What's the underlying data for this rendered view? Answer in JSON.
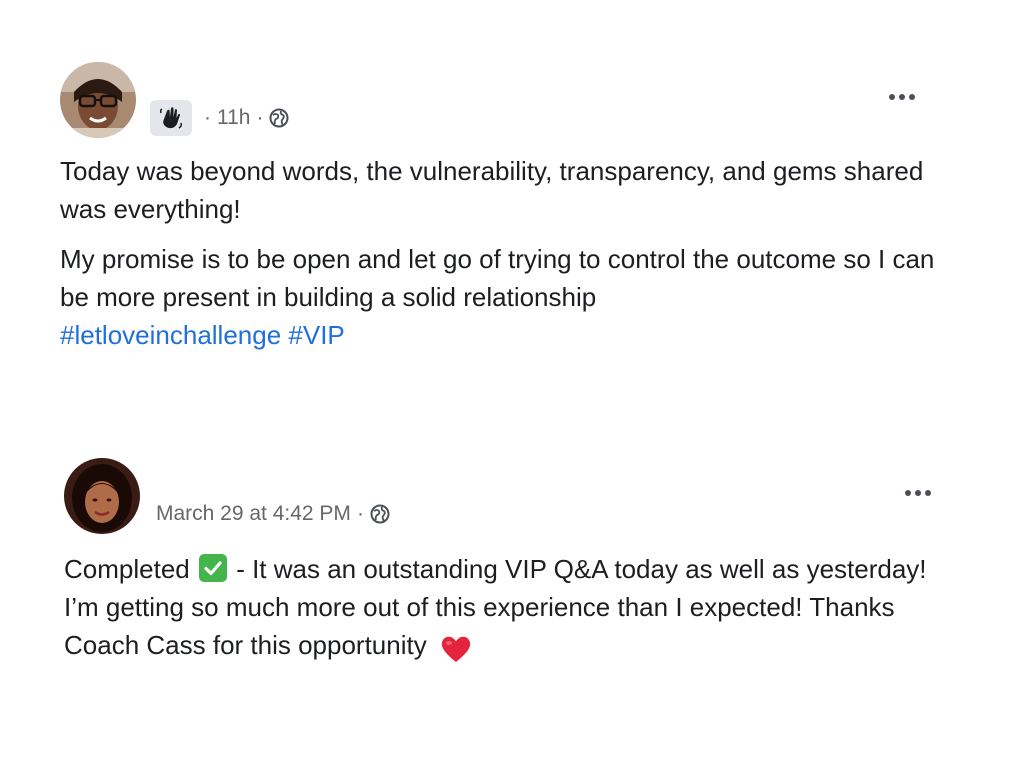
{
  "posts": [
    {
      "avatar_icon": "user-avatar",
      "badge_icon": "waving-hand-icon",
      "timestamp": "11h",
      "separator": "·",
      "audience_icon": "globe-icon",
      "more_icon": "more-options-icon",
      "paragraphs": [
        "Today was beyond words, the vulnerability, transparency, and gems shared was everything!",
        "My promise is to be open and let go of trying to control the outcome so I can be more present in building a solid relationship"
      ],
      "hashtags": [
        "#letloveinchallenge",
        "#VIP"
      ]
    },
    {
      "avatar_icon": "user-avatar",
      "timestamp": "March 29 at 4:42 PM",
      "separator": "·",
      "audience_icon": "globe-icon",
      "more_icon": "more-options-icon",
      "text_before_check": "Completed",
      "text_after_check": " - It was an outstanding VIP Q&A today as well as yesterday! I’m getting so much more out of this experience than I expected! Thanks Coach Cass for this opportunity",
      "check_emoji": "check-mark-emoji",
      "heart_emoji": "red-heart-emoji"
    }
  ],
  "colors": {
    "hashtag": "#216fdb",
    "meta_text": "#65676b",
    "body_text": "#1c1e21",
    "check_green": "#43b54a",
    "heart_red": "#e5243b"
  }
}
